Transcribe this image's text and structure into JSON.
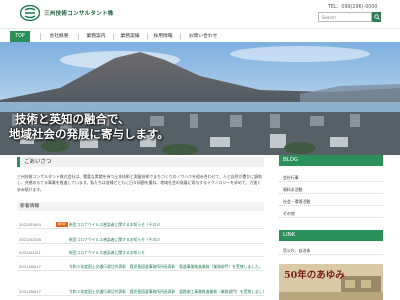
{
  "header": {
    "logo_text": "三州技術コンサルタント株",
    "tel": "TEL：099(296)-0000",
    "search_placeholder": "Search"
  },
  "nav": {
    "items": [
      {
        "label": "TOP",
        "active": true
      },
      {
        "label": "会社概要"
      },
      {
        "label": "業務案内"
      },
      {
        "label": "業務実績"
      },
      {
        "label": "採用情報"
      },
      {
        "label": "お問い合わせ"
      }
    ]
  },
  "hero": {
    "line1": "技術と英知の融合で、",
    "line2": "地域社会の発展に寄与します。"
  },
  "main": {
    "greeting_title": "ごあいさつ",
    "greeting_text": "三州技術コンサルタント株式会社は、豊富な実績を持つ土木技術と測量技術でまちづくりのノウハウを組み合わせて、人と自然が豊かに調和し、共感のもてる事業を推進しています。私たちは皆様とともに日々研鑽を重ね、地域社会の発展に寄与するテクノロジーを求めて、力強く歩み続けます。",
    "news_title": "新着情報",
    "news": [
      {
        "date": "2022/03/04",
        "new": "NEW",
        "title": "新型コロナウイルス感染者に関するお知らせ（その3）"
      },
      {
        "date": "2022/02/28",
        "title": "新型コロナウイルス感染者に関するお知らせ（その2）"
      },
      {
        "date": "2022/02/21",
        "title": "新型コロナウイルス感染者に関するお知らせ"
      },
      {
        "date": "2021/08/17",
        "title": "令和３年度国土交通行政功労表彰　鹿児島国道事務所所長表彰　県道事業推進業務（業務部門）を受賞しました。"
      },
      {
        "date": "2021/08/17",
        "title": "令和３年度国土交通行政功労表彰　鹿児島国道事務所所長表彰　道路施工事業推進業務（業務部門）を受賞しました。"
      }
    ]
  },
  "sidebar": {
    "blog_title": "BLOG",
    "blog_items": [
      "会社行事",
      "資料お活動",
      "社会・環境活動",
      "その他"
    ],
    "link_title": "LINK",
    "link_items": [
      "官公庁、自治体"
    ],
    "banner_text": "50年のあゆみ"
  },
  "colors": {
    "brand_green": "#2b8f5a",
    "accent_orange": "#e2661e"
  }
}
